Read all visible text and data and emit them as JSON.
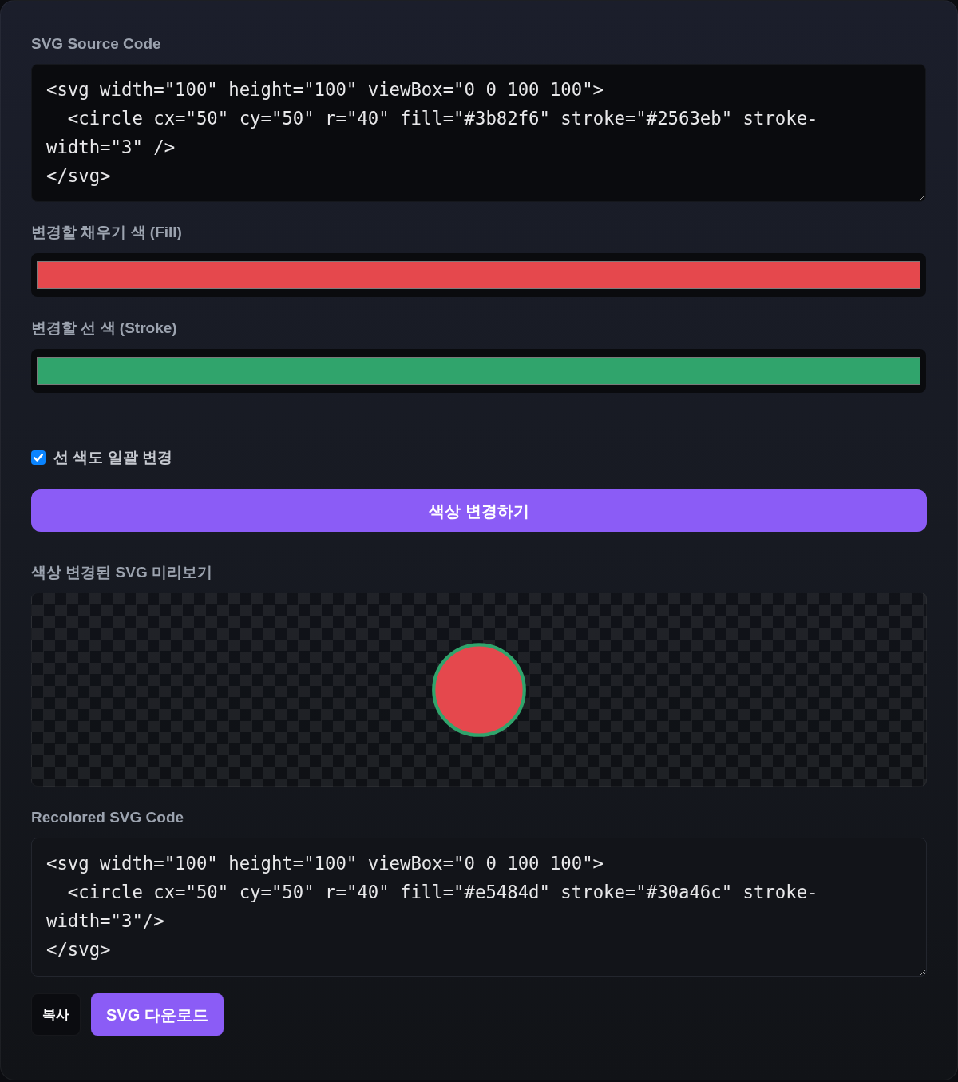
{
  "source": {
    "label": "SVG Source Code",
    "code": "<svg width=\"100\" height=\"100\" viewBox=\"0 0 100 100\">\n  <circle cx=\"50\" cy=\"50\" r=\"40\" fill=\"#3b82f6\" stroke=\"#2563eb\" stroke-width=\"3\" />\n</svg>"
  },
  "color_inputs": [
    {
      "label": "변경할 채우기 색 (Fill)",
      "color": "#e5484d"
    },
    {
      "label": "변경할 선 색 (Stroke)",
      "color": "#30a46c"
    }
  ],
  "bulk_stroke": {
    "label": "선 색도 일괄 변경",
    "checked": true
  },
  "apply_button": "색상 변경하기",
  "preview": {
    "label": "색상 변경된 SVG 미리보기"
  },
  "result": {
    "label": "Recolored SVG Code",
    "code": "<svg width=\"100\" height=\"100\" viewBox=\"0 0 100 100\">\n  <circle cx=\"50\" cy=\"50\" r=\"40\" fill=\"#e5484d\" stroke=\"#30a46c\" stroke-width=\"3\"/>\n</svg>"
  },
  "buttons": [
    {
      "label": "복사",
      "kind": "secondary"
    },
    {
      "label": "SVG 다운로드",
      "kind": "primary"
    }
  ]
}
